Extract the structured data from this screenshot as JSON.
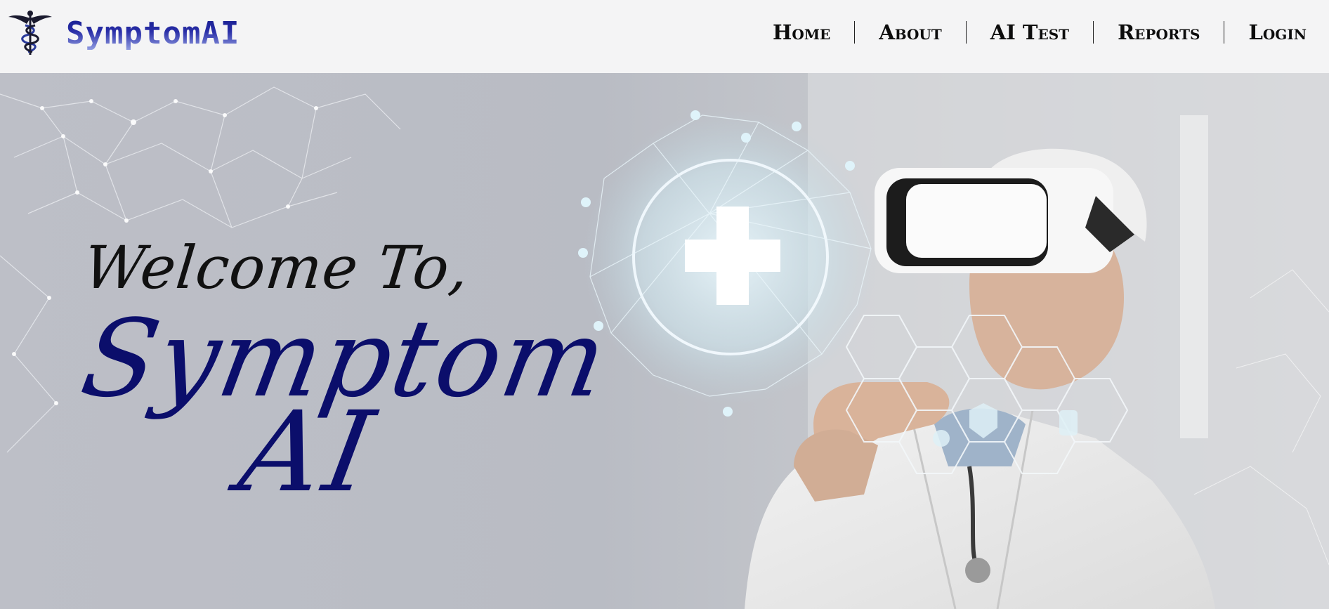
{
  "brand": {
    "name": "SymptomAI",
    "logo_icon": "caduceus-icon"
  },
  "nav": {
    "items": [
      {
        "label": "Home"
      },
      {
        "label": "About"
      },
      {
        "label": "AI Test"
      },
      {
        "label": "Reports"
      },
      {
        "label": "Login"
      }
    ]
  },
  "hero": {
    "welcome": "Welcome To,",
    "title_line1": "Symptom",
    "title_line2": "AI",
    "image_description_icon": "doctor-vr-headset-icon"
  },
  "colors": {
    "accent": "#0b0e6b",
    "brand_gradient_top": "#141a8c",
    "brand_gradient_bottom": "#9aa6e6",
    "nav_bg": "#f4f4f5",
    "hero_bg": "#bdbfc7"
  }
}
